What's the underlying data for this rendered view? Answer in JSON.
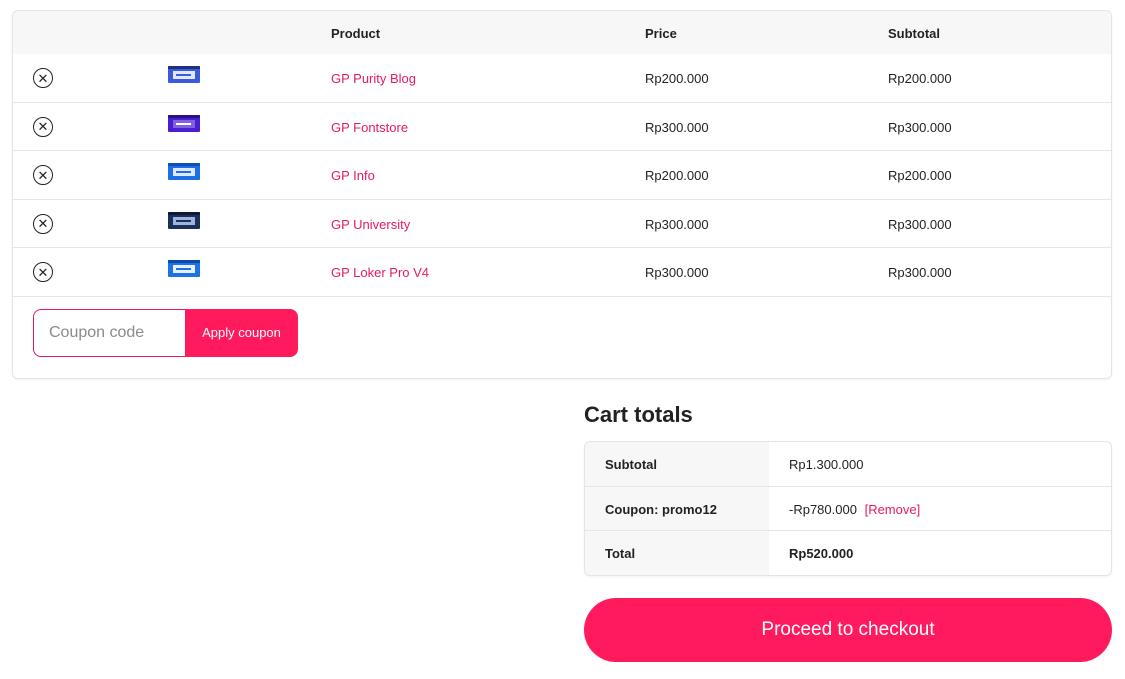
{
  "cart": {
    "headers": {
      "product": "Product",
      "price": "Price",
      "subtotal": "Subtotal"
    },
    "remove_glyph": "✕",
    "items": [
      {
        "name": "GP Purity Blog",
        "price": "Rp200.000",
        "subtotal": "Rp200.000",
        "thumb_color": "#3b5bdb"
      },
      {
        "name": "GP Fontstore",
        "price": "Rp300.000",
        "subtotal": "Rp300.000",
        "thumb_color": "#4b1fd1"
      },
      {
        "name": "GP Info",
        "price": "Rp200.000",
        "subtotal": "Rp200.000",
        "thumb_color": "#1e6ee8"
      },
      {
        "name": "GP University",
        "price": "Rp300.000",
        "subtotal": "Rp300.000",
        "thumb_color": "#1c2f5c"
      },
      {
        "name": "GP Loker Pro V4",
        "price": "Rp300.000",
        "subtotal": "Rp300.000",
        "thumb_color": "#1a73e8"
      }
    ],
    "coupon": {
      "placeholder": "Coupon code",
      "value": "",
      "button_label": "Apply coupon"
    }
  },
  "totals": {
    "title": "Cart totals",
    "subtotal_label": "Subtotal",
    "subtotal_value": "Rp1.300.000",
    "coupon_label": "Coupon: promo12",
    "coupon_value": "-Rp780.000",
    "coupon_remove": "[Remove]",
    "total_label": "Total",
    "total_value": "Rp520.000"
  },
  "checkout": {
    "label": "Proceed to checkout"
  },
  "colors": {
    "accent": "#ff1a5e",
    "link": "#e8195f"
  }
}
